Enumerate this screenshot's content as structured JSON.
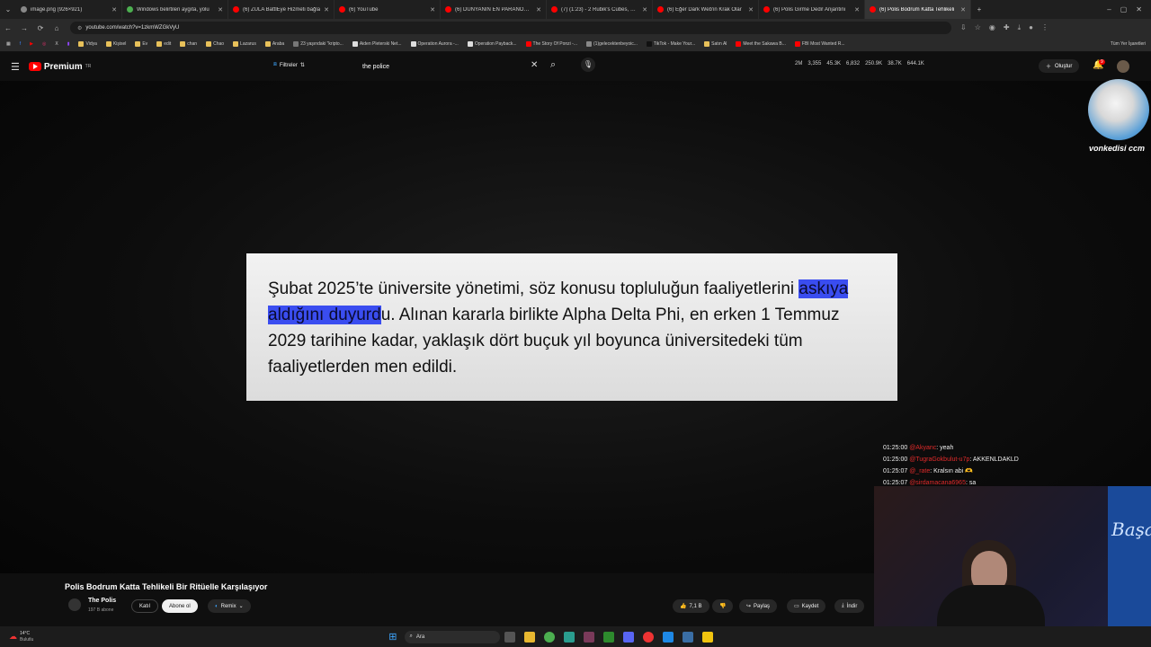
{
  "browser": {
    "tabs": [
      {
        "title": "image.png (926×921)",
        "color": "#888",
        "active": false
      },
      {
        "title": "Windows belirtilen aygıta, yolu",
        "color": "#4caf50",
        "active": false
      },
      {
        "title": "(6) ZULA BattlEye Hizmeti bağla",
        "color": "#f00",
        "active": false
      },
      {
        "title": "(6) YouTube",
        "color": "#f00",
        "active": false
      },
      {
        "title": "(6) DÜNYANIN EN PARANORMAL",
        "color": "#f00",
        "active": false
      },
      {
        "title": "(7) (1:23) - 2 Rubik's Cubes, 2 C",
        "color": "#f00",
        "active": false
      },
      {
        "title": "(6) Eğer Dark Web'in Krak Olar",
        "color": "#f00",
        "active": false
      },
      {
        "title": "(6) Polis Girme Dedi! Anjantini",
        "color": "#f00",
        "active": false
      },
      {
        "title": "(6) Polis Bodrum Katta Tehlikeli",
        "color": "#f00",
        "active": true
      }
    ],
    "new_tab": "+",
    "url": "youtube.com/watch?v=1zkmWZGkVyU",
    "bookmarks": [
      {
        "label": "Vidya",
        "color": "#e8c15a"
      },
      {
        "label": "Kişisel",
        "color": "#e8c15a"
      },
      {
        "label": "Ev",
        "color": "#e8c15a"
      },
      {
        "label": "edit",
        "color": "#e8c15a"
      },
      {
        "label": "chan",
        "color": "#e8c15a"
      },
      {
        "label": "Chao",
        "color": "#e8c15a"
      },
      {
        "label": "Lazarus",
        "color": "#e8c15a"
      },
      {
        "label": "Araba",
        "color": "#e8c15a"
      },
      {
        "label": "23 yaşındaki \"kripto...",
        "color": "#777"
      },
      {
        "label": "Aiden Pleterski Net...",
        "color": "#ddd"
      },
      {
        "label": "Operation Aurora -...",
        "color": "#ddd"
      },
      {
        "label": "Operation Payback...",
        "color": "#ddd"
      },
      {
        "label": "The Story Of Ponzi -...",
        "color": "#f00"
      },
      {
        "label": "(1)gelecektenbeyoic...",
        "color": "#888"
      },
      {
        "label": "TikTok - Make Your...",
        "color": "#111"
      },
      {
        "label": "Satın Al",
        "color": "#e8c15a"
      },
      {
        "label": "Meet the Sakawa B...",
        "color": "#f00"
      },
      {
        "label": "FBI Most Wanted R...",
        "color": "#f00"
      }
    ],
    "all_bookmarks": "Tüm Yer İşaretleri"
  },
  "youtube": {
    "logo_text": "Premium",
    "logo_badge": "TR",
    "filters_label": "Filtreler",
    "search_value": "the police",
    "stats": [
      "2M",
      "3,355",
      "45.3K",
      "6,832",
      "250.9K",
      "38.7K",
      "644.1K"
    ],
    "create_label": "Oluştur",
    "notif_count": "9"
  },
  "video": {
    "caption_before": "Şubat 2025’te üniversite yönetimi, söz konusu topluluğun faaliyetlerini ",
    "caption_highlight": "askıya aldığını duyurd",
    "caption_after": "u. Alınan kararla birlikte Alpha Delta Phi, en erken 1 Temmuz 2029 tarihine kadar, yaklaşık dört buçuk yıl boyunca üniversitedeki tüm faaliyetlerden men edildi.",
    "overlay_name": "vonkedisi ccm"
  },
  "chat": [
    {
      "time": "01:25:00",
      "user": "@Akyanc",
      "msg": "yeah"
    },
    {
      "time": "01:25:00",
      "user": "@TugraGokbulut-u7p",
      "msg": "AKKENLDAKLD"
    },
    {
      "time": "01:25:07",
      "user": "@_rate",
      "msg": "Kralsın abi 🫶"
    },
    {
      "time": "01:25:07",
      "user": "@sirdamacana6965",
      "msg": "sa"
    }
  ],
  "video_info": {
    "title": "Polis Bodrum Katta Tehlikeli Bir Ritüelle Karşılaşıyor",
    "channel": "The Polis",
    "subs": "197 B abone",
    "join_label": "Katıl",
    "subscribe_label": "Abone ol",
    "remix_label": "Remix",
    "likes": "7,1 B",
    "share_label": "Paylaş",
    "save_label": "Kaydet",
    "download_label": "İndir"
  },
  "webcam_text": "Başa",
  "taskbar": {
    "weather_temp": "14°C",
    "weather_desc": "Bulutlu",
    "search_label": "Ara"
  }
}
